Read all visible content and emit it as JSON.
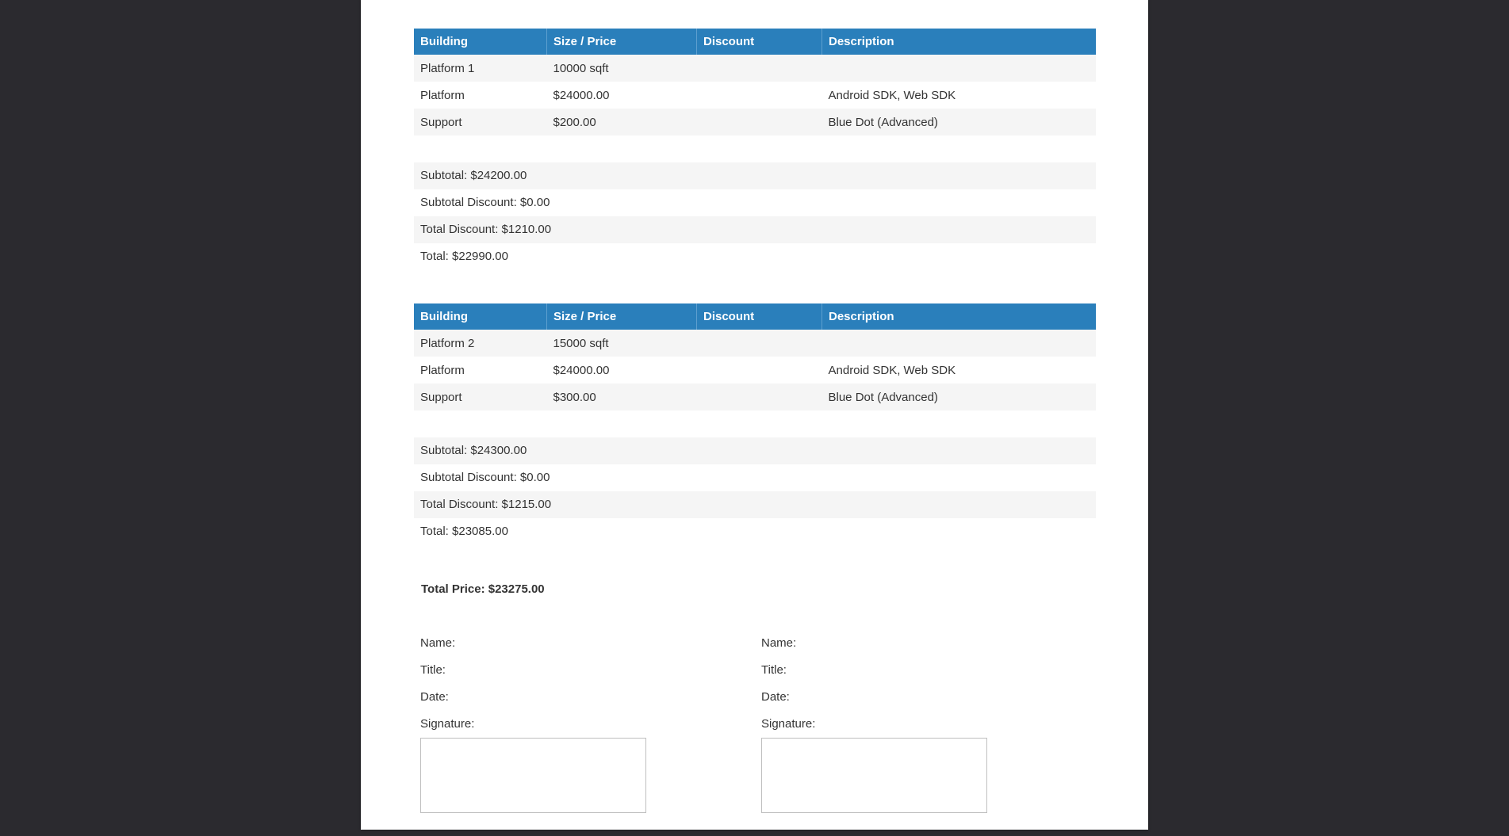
{
  "tables": [
    {
      "headers": [
        "Building",
        "Size / Price",
        "Discount",
        "Description"
      ],
      "rows": [
        {
          "building": "Platform 1",
          "size_price": "10000 sqft",
          "discount": "",
          "description": ""
        },
        {
          "building": "Platform",
          "size_price": "$24000.00",
          "discount": "",
          "description": "Android SDK, Web SDK"
        },
        {
          "building": "Support",
          "size_price": "$200.00",
          "discount": "",
          "description": "Blue Dot (Advanced)"
        }
      ],
      "summary": {
        "subtotal": "Subtotal: $24200.00",
        "subtotal_discount": "Subtotal Discount: $0.00",
        "total_discount": "Total Discount: $1210.00",
        "total": "Total: $22990.00"
      }
    },
    {
      "headers": [
        "Building",
        "Size / Price",
        "Discount",
        "Description"
      ],
      "rows": [
        {
          "building": "Platform 2",
          "size_price": "15000 sqft",
          "discount": "",
          "description": ""
        },
        {
          "building": "Platform",
          "size_price": "$24000.00",
          "discount": "",
          "description": "Android SDK, Web SDK"
        },
        {
          "building": "Support",
          "size_price": "$300.00",
          "discount": "",
          "description": "Blue Dot (Advanced)"
        }
      ],
      "summary": {
        "subtotal": "Subtotal: $24300.00",
        "subtotal_discount": "Subtotal Discount: $0.00",
        "total_discount": "Total Discount: $1215.00",
        "total": "Total: $23085.00"
      }
    }
  ],
  "total_price": "Total Price: $23275.00",
  "signature_blocks": [
    {
      "name_label": "Name:",
      "title_label": "Title:",
      "date_label": "Date:",
      "signature_label": "Signature:"
    },
    {
      "name_label": "Name:",
      "title_label": "Title:",
      "date_label": "Date:",
      "signature_label": "Signature:"
    }
  ],
  "colors": {
    "header_bg": "#2a7fbb",
    "viewer_bg": "#2b2a2f",
    "row_stripe": "#f5f5f5"
  }
}
